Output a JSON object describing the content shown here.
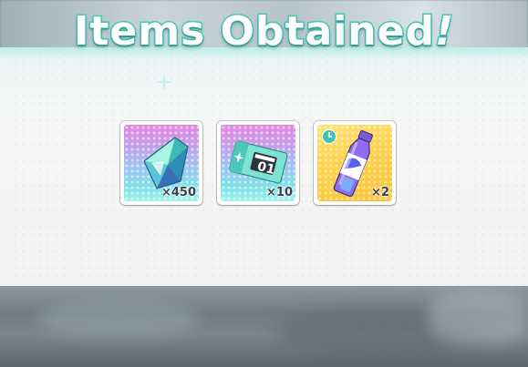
{
  "dialog": {
    "title": "Items Obtained",
    "title_suffix": "!"
  },
  "items": [
    {
      "name": "crystal-icon",
      "quantity": "×450",
      "badge": null
    },
    {
      "name": "ticket-icon",
      "quantity": "×10",
      "ticket_number": "01",
      "badge": null
    },
    {
      "name": "energy-drink-icon",
      "quantity": "×2",
      "badge": "clock-icon"
    }
  ],
  "colors": {
    "title_outline": "#46c9b8",
    "accent": "#3fc5b3",
    "panel": "#f4f6f6"
  }
}
